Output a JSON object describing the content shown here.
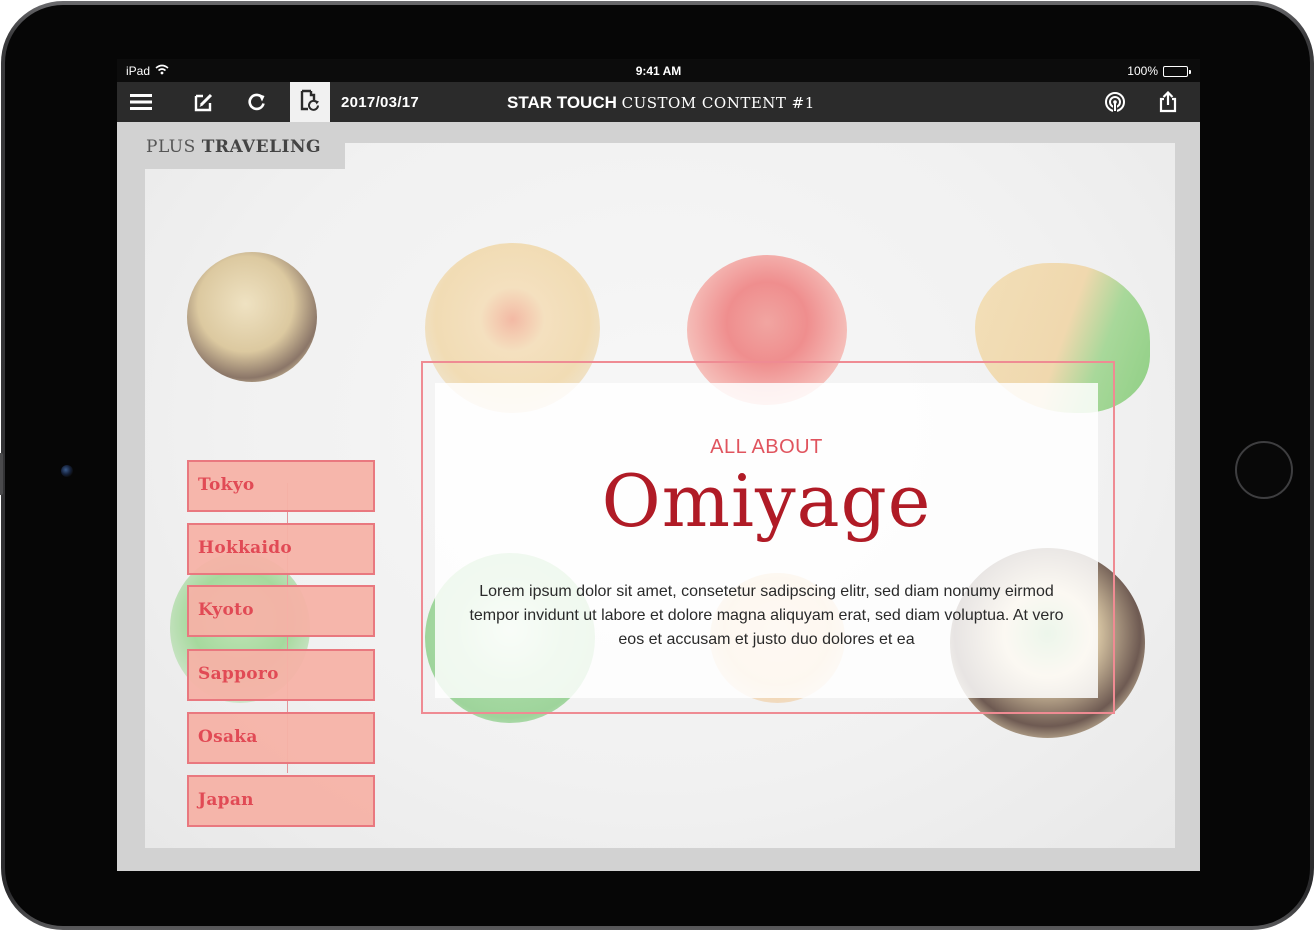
{
  "status_bar": {
    "device_name": "iPad",
    "time": "9:41 AM",
    "battery_percent": "100%",
    "battery_level": 1.0
  },
  "toolbar": {
    "date": "2017/03/17",
    "title_bold": "STAR TOUCH",
    "title_rest": "CUSTOM CONTENT #1",
    "icons": [
      "menu-icon",
      "edit-icon",
      "refresh-icon",
      "page-reload-icon",
      "broadcast-icon",
      "share-icon"
    ]
  },
  "section": {
    "prefix": "PLUS",
    "name": "TRAVELING"
  },
  "cities": [
    {
      "label": "Tokyo"
    },
    {
      "label": "Hokkaido"
    },
    {
      "label": "Kyoto"
    },
    {
      "label": "Sapporo"
    },
    {
      "label": "Osaka"
    },
    {
      "label": "Japan"
    }
  ],
  "hero": {
    "kicker": "ALL ABOUT",
    "title": "Omiyage",
    "body": "Lorem ipsum dolor sit amet, consetetur sadipscing elitr, sed diam nonumy eirmod tempor invidunt ut labore et dolore magna aliquyam erat, sed diam voluptua. At vero eos et accusam et justo duo dolores et ea"
  },
  "colors": {
    "accent_red": "#b01b26",
    "city_fill": "#f6b2a6",
    "city_text": "#e14a55",
    "toolbar_bg": "#2b2b2b"
  }
}
